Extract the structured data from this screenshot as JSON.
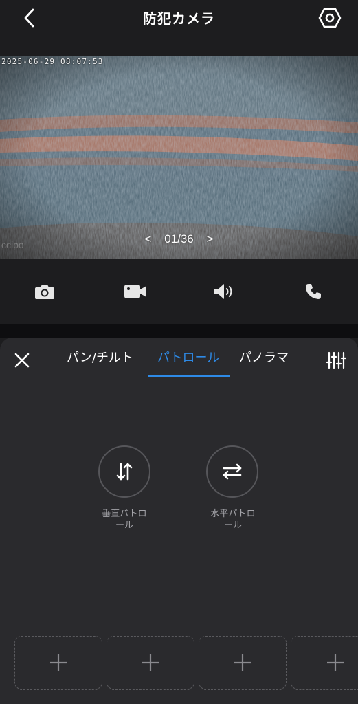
{
  "header": {
    "title": "防犯カメラ",
    "back_icon": "chevron-left-icon",
    "settings_icon": "hex-gear-icon"
  },
  "video": {
    "timestamp": "2025-06-29  08:07:53",
    "watermark": "ccipo",
    "pager": {
      "prev": "<",
      "current": "01/36",
      "next": ">"
    }
  },
  "controls": [
    {
      "name": "snapshot",
      "icon": "camera-icon"
    },
    {
      "name": "record",
      "icon": "video-camera-icon"
    },
    {
      "name": "speaker",
      "icon": "speaker-icon"
    },
    {
      "name": "call",
      "icon": "phone-icon"
    }
  ],
  "panel": {
    "tabs": [
      {
        "label": "パン/チルト",
        "active": false
      },
      {
        "label": "パトロール",
        "active": true
      },
      {
        "label": "パノラマ",
        "active": false
      }
    ],
    "patrol": {
      "vertical": {
        "line1": "垂直パトロ",
        "line2": "ール"
      },
      "horizontal": {
        "line1": "水平パトロ",
        "line2": "ール"
      }
    },
    "presets": [
      {
        "symbol": "+"
      },
      {
        "symbol": "+"
      },
      {
        "symbol": "+"
      },
      {
        "symbol": "+"
      }
    ]
  },
  "colors": {
    "accent": "#2e8ae6",
    "background": "#1d1d1f",
    "panel": "#2a2a2d"
  }
}
